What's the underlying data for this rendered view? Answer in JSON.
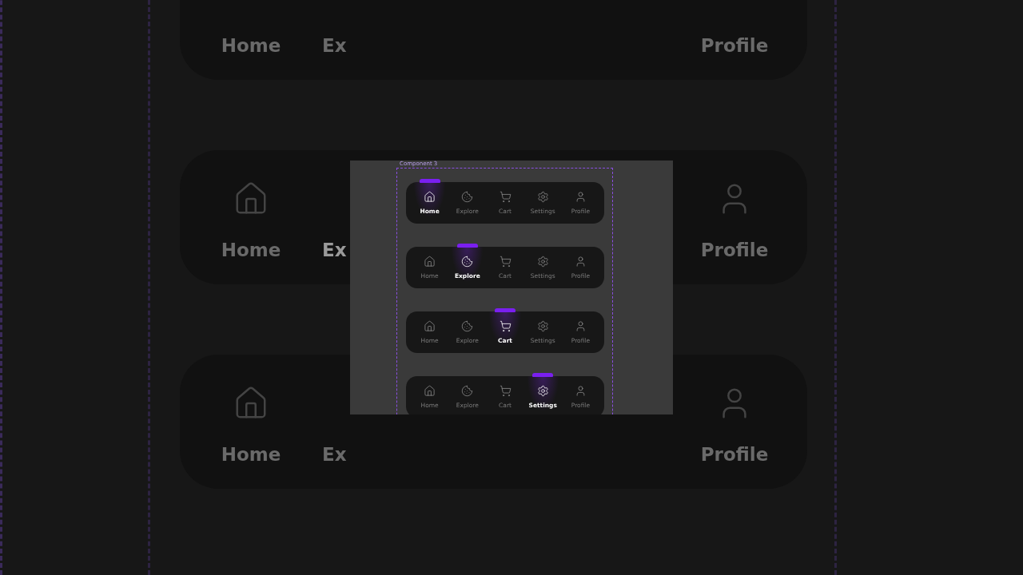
{
  "backdrop": {
    "rows": [
      {
        "items": [
          {
            "label": "Home",
            "selected": false
          },
          {
            "label": "Ex",
            "selected": false
          },
          {
            "label": "Profile",
            "selected": false
          }
        ]
      },
      {
        "items": [
          {
            "label": "Home",
            "kind": "home",
            "selected": false
          },
          {
            "label": "Ex",
            "selected": true
          },
          {
            "label": "Profile",
            "kind": "profile",
            "selected": false
          }
        ]
      },
      {
        "items": [
          {
            "label": "Home",
            "kind": "home",
            "selected": false
          },
          {
            "label": "Ex",
            "selected": false
          },
          {
            "label": "Profile",
            "kind": "profile",
            "selected": false
          }
        ]
      }
    ]
  },
  "canvas": {
    "frame_label": "Component 3",
    "nav_bars": [
      {
        "items": [
          {
            "label": "Home",
            "kind": "home",
            "selected": true
          },
          {
            "label": "Explore",
            "kind": "explore",
            "selected": false
          },
          {
            "label": "Cart",
            "kind": "cart",
            "selected": false
          },
          {
            "label": "Settings",
            "kind": "settings",
            "selected": false
          },
          {
            "label": "Profile",
            "kind": "profile",
            "selected": false
          }
        ]
      },
      {
        "items": [
          {
            "label": "Home",
            "kind": "home",
            "selected": false
          },
          {
            "label": "Explore",
            "kind": "explore",
            "selected": true
          },
          {
            "label": "Cart",
            "kind": "cart",
            "selected": false
          },
          {
            "label": "Settings",
            "kind": "settings",
            "selected": false
          },
          {
            "label": "Profile",
            "kind": "profile",
            "selected": false
          }
        ]
      },
      {
        "items": [
          {
            "label": "Home",
            "kind": "home",
            "selected": false
          },
          {
            "label": "Explore",
            "kind": "explore",
            "selected": false
          },
          {
            "label": "Cart",
            "kind": "cart",
            "selected": true
          },
          {
            "label": "Settings",
            "kind": "settings",
            "selected": false
          },
          {
            "label": "Profile",
            "kind": "profile",
            "selected": false
          }
        ]
      },
      {
        "items": [
          {
            "label": "Home",
            "kind": "home",
            "selected": false
          },
          {
            "label": "Explore",
            "kind": "explore",
            "selected": false
          },
          {
            "label": "Cart",
            "kind": "cart",
            "selected": false
          },
          {
            "label": "Settings",
            "kind": "settings",
            "selected": true
          },
          {
            "label": "Profile",
            "kind": "profile",
            "selected": false
          }
        ]
      }
    ]
  }
}
